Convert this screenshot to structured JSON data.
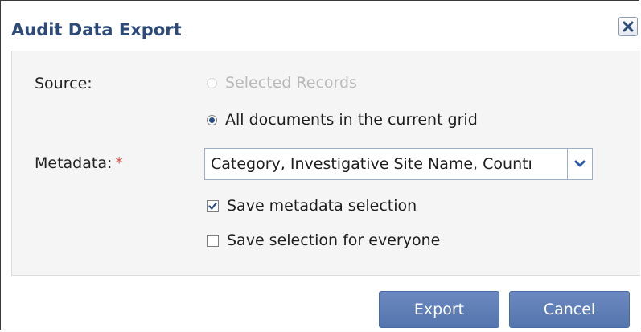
{
  "dialog": {
    "title": "Audit Data Export",
    "close_icon": "close-x-icon"
  },
  "form": {
    "source_label": "Source:",
    "source_options": [
      {
        "label": "Selected Records",
        "selected": false,
        "disabled": true
      },
      {
        "label": "All documents in the current grid",
        "selected": true,
        "disabled": false
      }
    ],
    "metadata_label": "Metadata:",
    "metadata_required_mark": "*",
    "metadata_value": "Category, Investigative Site Name, Countı",
    "metadata_dropdown_icon": "chevron-down-icon",
    "save_metadata_label": "Save metadata selection",
    "save_metadata_checked": true,
    "save_everyone_label": "Save selection for everyone",
    "save_everyone_checked": false
  },
  "buttons": {
    "export_label": "Export",
    "cancel_label": "Cancel"
  },
  "colors": {
    "title": "#2d4a78",
    "required": "#d9534f",
    "button": "#5f7fb7",
    "panel_bg": "#f5f5f5"
  }
}
